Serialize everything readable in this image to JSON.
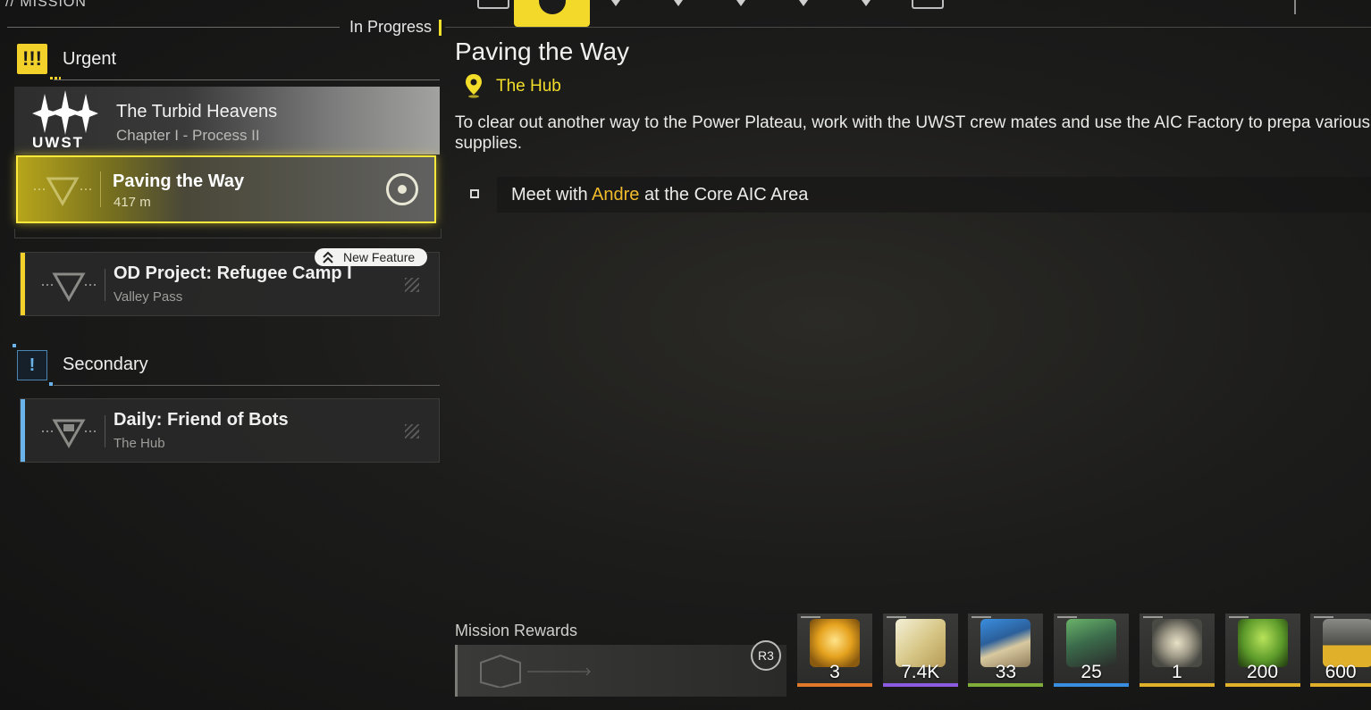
{
  "header": {
    "title": "// MISSION",
    "filter_status": "In Progress",
    "active_tab": "ALL"
  },
  "colors": {
    "accent_yellow": "#f3d92a",
    "urgent": "#f1d12a",
    "secondary": "#6ab3ea",
    "highlight_name": "#f2bb2a"
  },
  "sections": {
    "urgent": {
      "label": "Urgent",
      "icon": "triple-exclamation-icon"
    },
    "secondary": {
      "label": "Secondary",
      "icon": "exclamation-icon"
    }
  },
  "chapter": {
    "faction": "UWST",
    "title": "The Turbid Heavens",
    "subtitle": "Chapter I - Process II"
  },
  "missions": {
    "selected": {
      "title": "Paving the Way",
      "distance": "417 m"
    },
    "od_project": {
      "title": "OD Project: Refugee Camp I",
      "location": "Valley Pass",
      "badge": "New Feature"
    },
    "daily": {
      "title": "Daily: Friend of Bots",
      "location": "The Hub"
    }
  },
  "detail": {
    "title": "Paving the Way",
    "location": "The Hub",
    "description": "To clear out another way to the Power Plateau, work with the UWST crew mates and use the AIC Factory to prepa various supplies.",
    "objective": {
      "prefix": "Meet with ",
      "name": "Andre",
      "suffix": " at the Core AIC Area"
    }
  },
  "rewards": {
    "label": "Mission Rewards",
    "button_hint": "R3",
    "items": [
      {
        "icon": "gold-crystal-icon",
        "count": "3",
        "rarity_color": "#e07a2a"
      },
      {
        "icon": "currency-notes-icon",
        "count": "7.4K",
        "rarity_color": "#8d5be0"
      },
      {
        "icon": "exp-record-icon",
        "count": "33",
        "rarity_color": "#7fae3a"
      },
      {
        "icon": "device-kit-icon",
        "count": "25",
        "rarity_color": "#3a8ee0"
      },
      {
        "icon": "gear-component-icon",
        "count": "1",
        "rarity_color": "#e0b02a"
      },
      {
        "icon": "region-badge-icon",
        "count": "200",
        "rarity_color": "#e0b02a"
      },
      {
        "icon": "exp-icon",
        "count": "600",
        "rarity_color": "#e0b02a"
      }
    ]
  }
}
